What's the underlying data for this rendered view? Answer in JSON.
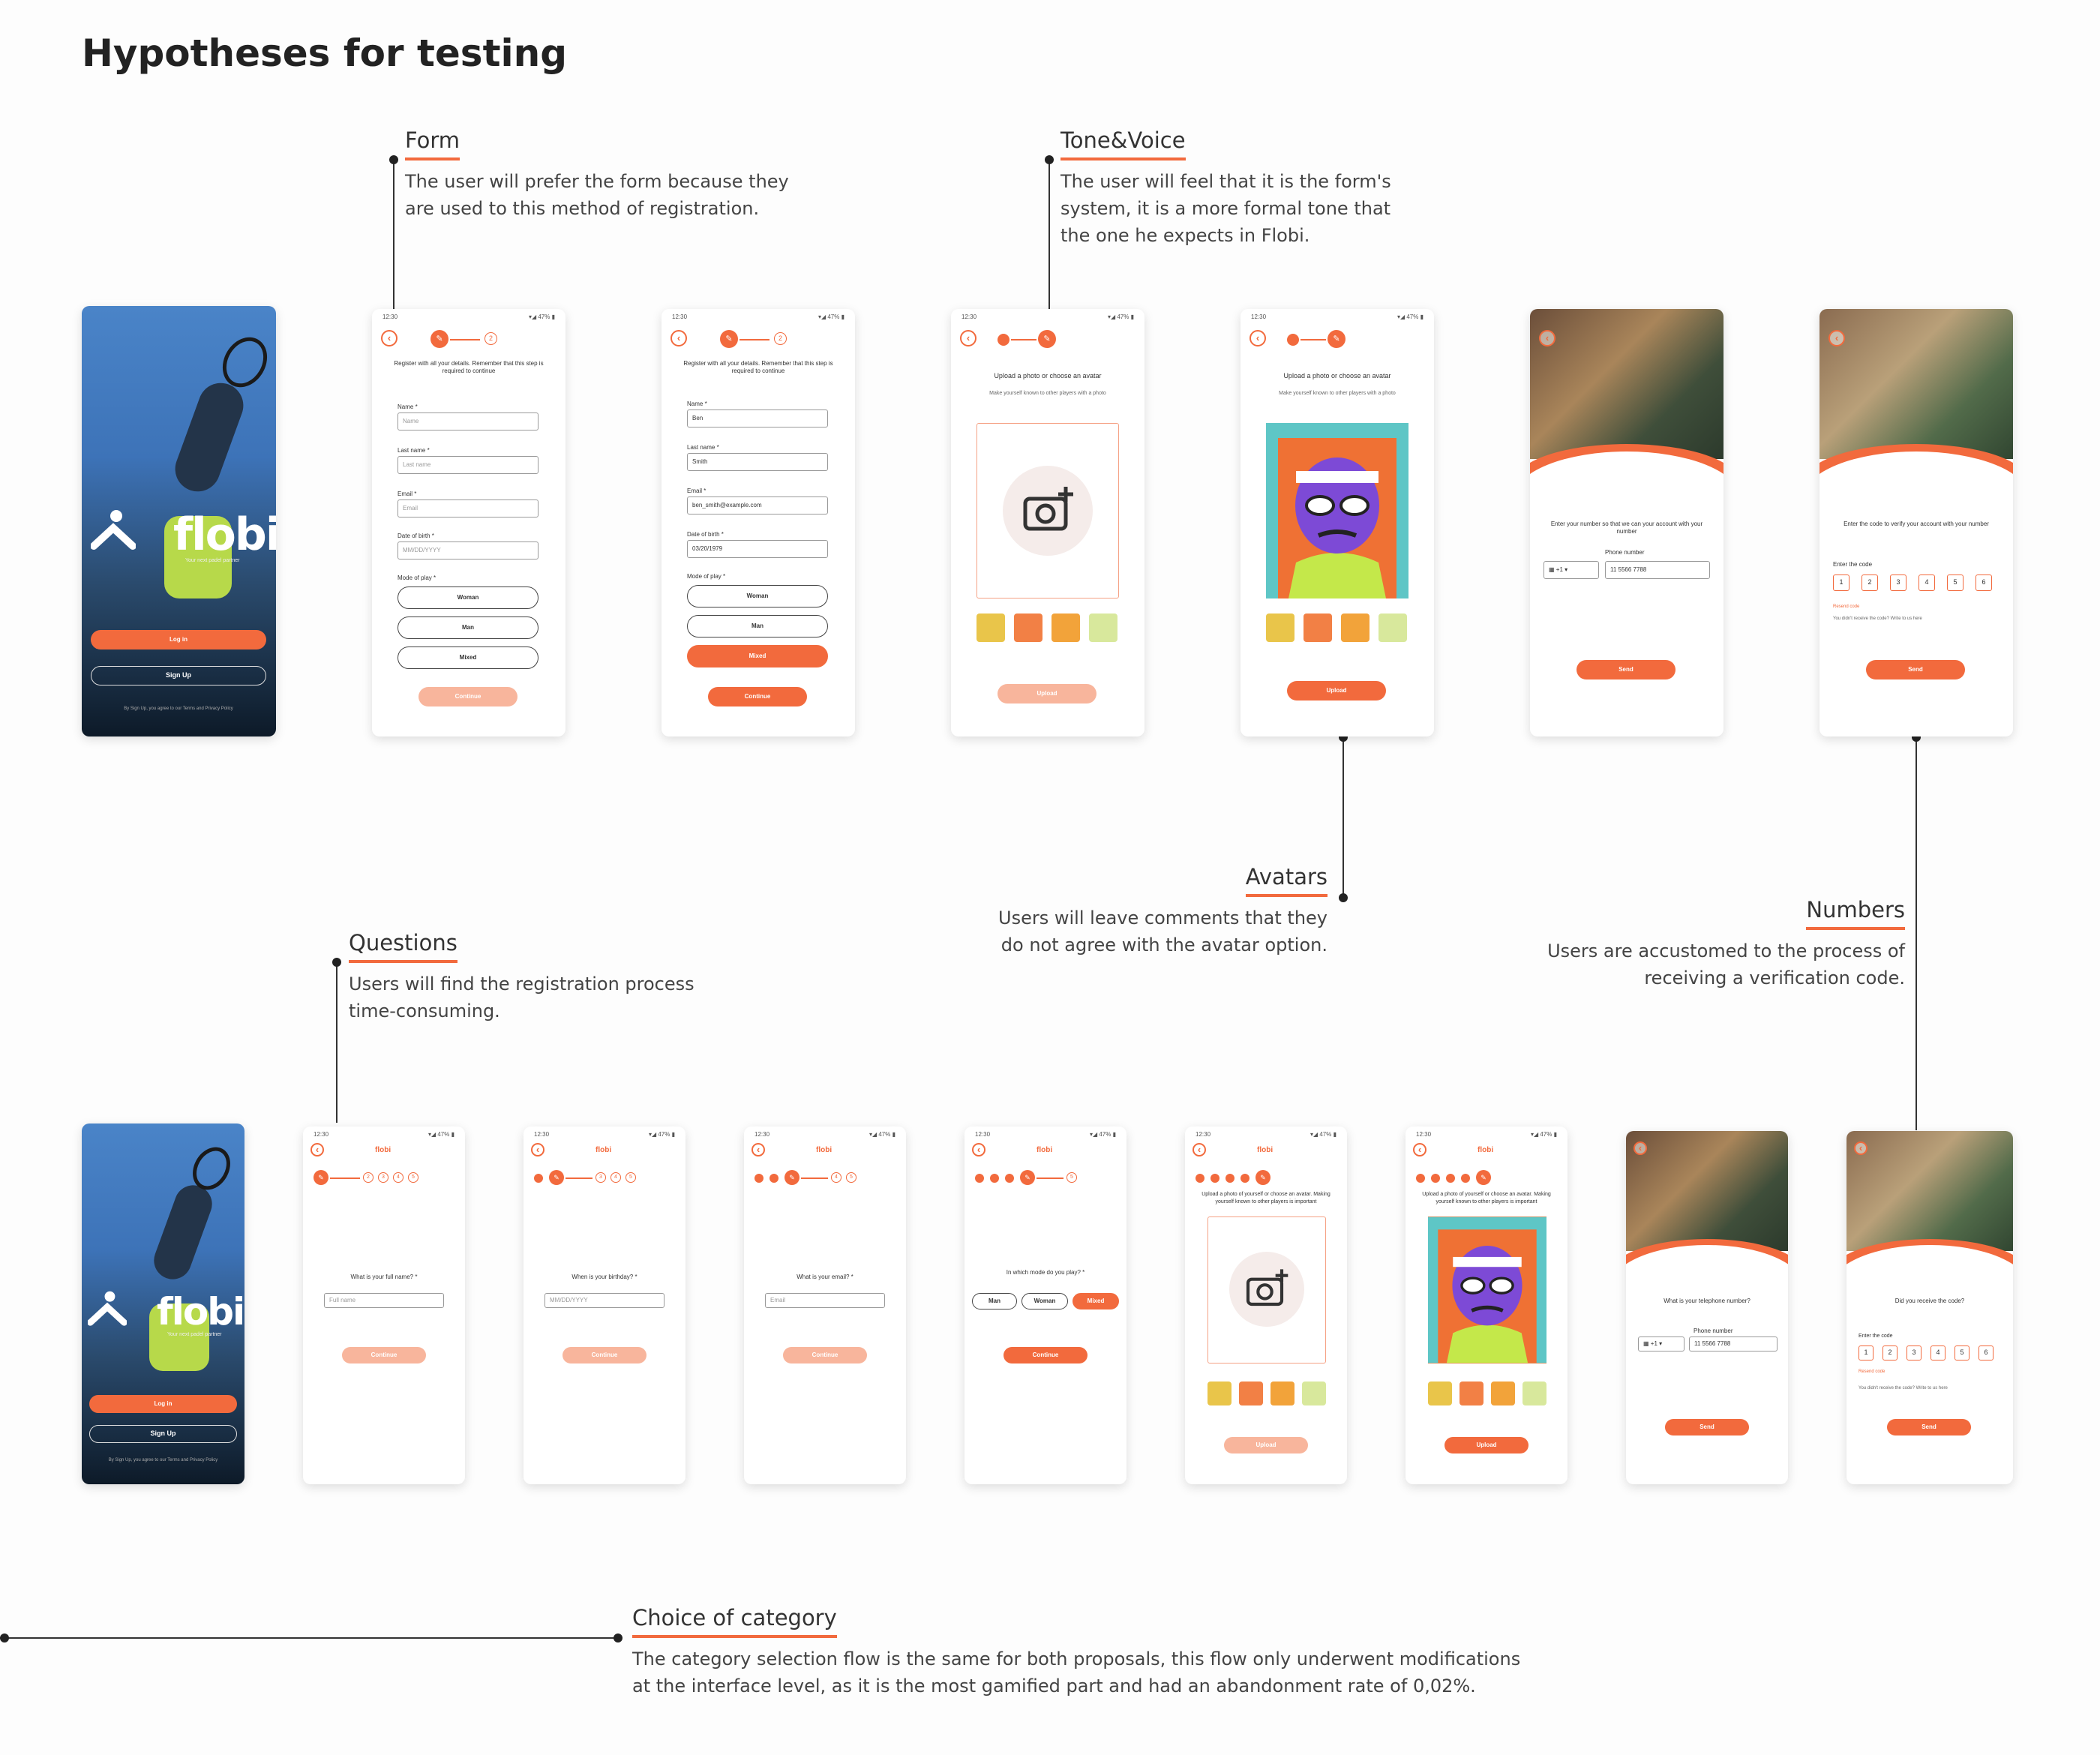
{
  "page_title": "Hypotheses for testing",
  "annotations": {
    "form": {
      "title": "Form",
      "text": "The user will prefer the form because they are used to this method of registration."
    },
    "tone": {
      "title": "Tone&Voice",
      "text": "The user will feel that it is the form's system, it is a more formal tone that the one he expects in Flobi."
    },
    "avatars": {
      "title": "Avatars",
      "text": "Users will leave comments that they do not agree with the avatar option."
    },
    "numbers": {
      "title": "Numbers",
      "text": "Users are accustomed to the process of receiving a verification code."
    },
    "questions": {
      "title": "Questions",
      "text": "Users will find the registration process time-consuming."
    },
    "category": {
      "title": "Choice of category",
      "text": "The category selection flow is the same for both proposals, this flow only underwent modifications at the interface level, as it is the most gamified part and had an abandonment rate of 0,02%."
    }
  },
  "splash": {
    "logo": "flobi",
    "tagline": "Your next padel partner",
    "login": "Log in",
    "signup": "Sign Up",
    "legal": "By Sign Up, you agree to our Terms and Privacy Policy"
  },
  "form_screen": {
    "header": "Register with all your details. Remember that this step is required to continue",
    "name_label": "Name *",
    "lastname_label": "Last name *",
    "email_label": "Email *",
    "dob_label": "Date of birth *",
    "mode_label": "Mode of play *",
    "name_ph": "Name",
    "lastname_ph": "Last name",
    "email_ph": "Email",
    "dob_ph": "MM/DD/YYYY",
    "name_val": "Ben",
    "lastname_val": "Smith",
    "email_val": "ben_smith@example.com",
    "dob_val": "03/20/1979",
    "opt_woman": "Woman",
    "opt_man": "Man",
    "opt_mixed": "Mixed",
    "continue": "Continue"
  },
  "upload_screen": {
    "header": "Upload a photo or choose an avatar",
    "sub": "Make yourself known to other players with a photo",
    "upload": "Upload"
  },
  "phone_screen": {
    "header": "Enter your number so that we can your account with your number",
    "label": "Phone number",
    "prefix": "+1",
    "value": "11 5566 7788",
    "send": "Send"
  },
  "code_screen": {
    "header": "Enter the code to verify your account with your number",
    "label": "Enter the code",
    "digits": [
      "1",
      "2",
      "3",
      "4",
      "5",
      "6"
    ],
    "resend": "Resend code",
    "hint": "You didn't receive the code? Write to us here",
    "send": "Send"
  },
  "q_screens": {
    "brand": "flobi",
    "q_name": "What is your full name? *",
    "ph_name": "Full name",
    "q_birth": "When is your birthday? *",
    "ph_birth": "MM/DD/YYYY",
    "q_email": "What is your email? *",
    "ph_email": "Email",
    "q_mode": "In which mode do you play? *",
    "opt_man": "Man",
    "opt_woman": "Woman",
    "opt_mixed": "Mixed",
    "continue": "Continue",
    "upload_header": "Upload a photo of yourself or choose an avatar. Making yourself known to other players is important",
    "upload": "Upload",
    "q_phone": "What is your telephone number?",
    "phone_label": "Phone number",
    "phone_prefix": "+1",
    "phone_value": "11 5566 7788",
    "send": "Send",
    "q_code": "Did you receive the code?",
    "code_label": "Enter the code",
    "digits": [
      "1",
      "2",
      "3",
      "4",
      "5",
      "6"
    ],
    "resend": "Resend code",
    "hint": "You didn't receive the code? Write to us here"
  },
  "status_time": "12:30",
  "status_icons": "▾◢ 47% ▮",
  "colors": {
    "accent": "#f26a3d",
    "accent_light": "#f8b59c"
  }
}
